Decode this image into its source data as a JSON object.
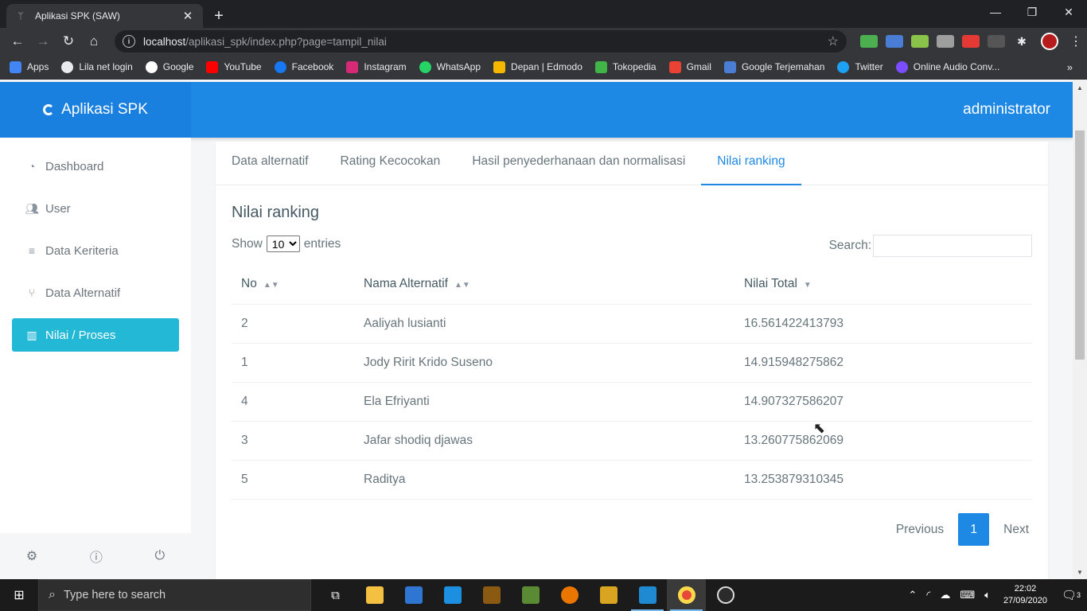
{
  "browser": {
    "tab_title": "Aplikasi SPK (SAW)",
    "url_host": "localhost",
    "url_path": "/aplikasi_spk/index.php?page=tampil_nilai",
    "bookmarks": [
      "Apps",
      "Lila net login",
      "Google",
      "YouTube",
      "Facebook",
      "Instagram",
      "WhatsApp",
      "Depan | Edmodo",
      "Tokopedia",
      "Gmail",
      "Google Terjemahan",
      "Twitter",
      "Online Audio Conv..."
    ]
  },
  "app": {
    "brand": "Aplikasi SPK",
    "user": "administrator"
  },
  "sidebar": {
    "items": [
      {
        "label": "Dashboard"
      },
      {
        "label": "User"
      },
      {
        "label": "Data Keriteria"
      },
      {
        "label": "Data Alternatif"
      },
      {
        "label": "Nilai / Proses"
      }
    ]
  },
  "tabs": [
    "Data alternatif",
    "Rating Kecocokan",
    "Hasil penyederhanaan dan normalisasi",
    "Nilai ranking"
  ],
  "content": {
    "title": "Nilai ranking",
    "show_label": "Show",
    "entries_value": "10",
    "entries_label": "entries",
    "search_label": "Search:",
    "search_placeholder": ""
  },
  "table": {
    "headers": [
      "No",
      "Nama Alternatif",
      "Nilai Total"
    ],
    "rows": [
      [
        "2",
        "Aaliyah lusianti",
        "16.561422413793"
      ],
      [
        "1",
        "Jody Ririt Krido Suseno",
        "14.915948275862"
      ],
      [
        "4",
        "Ela Efriyanti",
        "14.907327586207"
      ],
      [
        "3",
        "Jafar shodiq djawas",
        "13.260775862069"
      ],
      [
        "5",
        "Raditya",
        "13.253879310345"
      ]
    ]
  },
  "pagination": {
    "previous": "Previous",
    "page": "1",
    "next": "Next"
  },
  "taskbar": {
    "search_placeholder": "Type here to search",
    "time": "22:02",
    "date": "27/09/2020",
    "notif_count": "3"
  },
  "colors": {
    "primary": "#1e88e5",
    "active_menu": "#22b8d6"
  }
}
